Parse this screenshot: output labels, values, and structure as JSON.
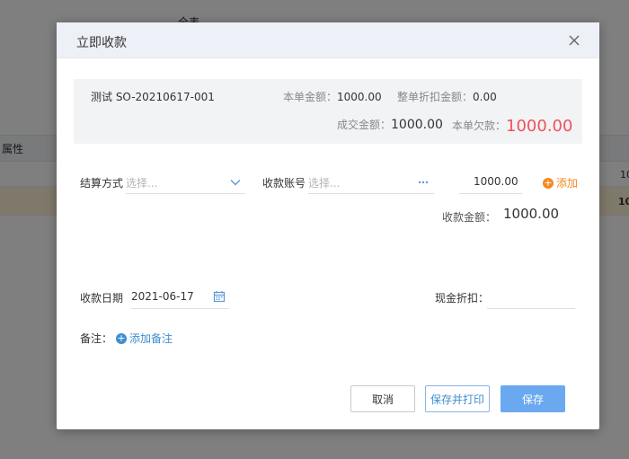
{
  "background": {
    "header_text": "全表",
    "col_attr": "属性",
    "row_val1": "10",
    "row_val2": "10"
  },
  "dialog": {
    "title": "立即收款",
    "summary": {
      "order_no": "测试 SO-20210617-001",
      "amount_label": "本单金额：",
      "amount_value": "1000.00",
      "discount_label": "整单折扣金额：",
      "discount_value": "0.00",
      "deal_label": "成交金额：",
      "deal_value": "1000.00",
      "debt_label": "本单欠款：",
      "debt_value": "1000.00"
    },
    "form": {
      "settle_label": "结算方式",
      "settle_placeholder": "选择...",
      "account_label": "收款账号",
      "account_placeholder": "选择...",
      "amount_value": "1000.00",
      "add_label": "添加",
      "collect_label": "收款金额：",
      "collect_value": "1000.00",
      "date_label": "收款日期",
      "date_value": "2021-06-17",
      "cash_discount_label": "现金折扣：",
      "cash_discount_value": "",
      "note_label": "备注：",
      "add_note_label": "添加备注"
    },
    "buttons": {
      "cancel": "取消",
      "save_print": "保存并打印",
      "save": "保存"
    }
  },
  "colors": {
    "accent_blue": "#3e8ed0",
    "accent_orange": "#f5891f",
    "debt_red": "#f0525c",
    "save_button": "#6aa8f0"
  }
}
